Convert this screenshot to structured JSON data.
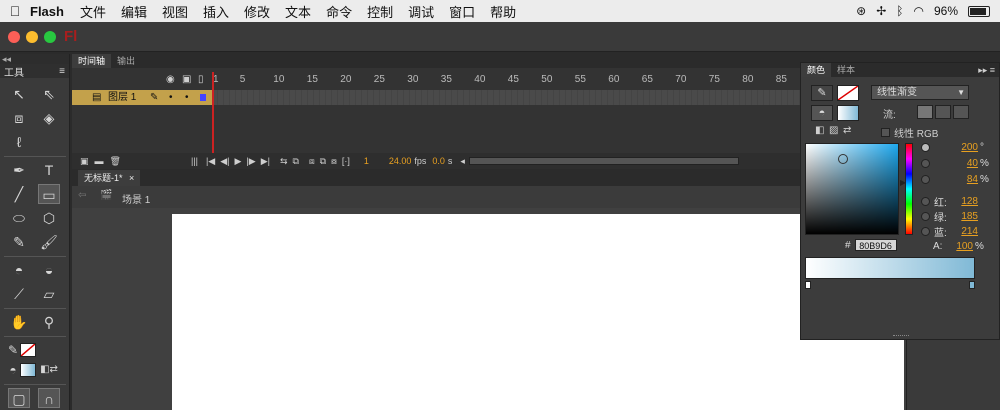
{
  "menubar": {
    "app_name": "Flash",
    "items": [
      "文件",
      "编辑",
      "视图",
      "插入",
      "修改",
      "文本",
      "命令",
      "控制",
      "调试",
      "窗口",
      "帮助"
    ],
    "battery": "96%"
  },
  "app": {
    "logo": "Fl"
  },
  "tools_panel": {
    "title": "工具",
    "strip": "◂◂"
  },
  "timeline": {
    "tabs": [
      "时间轴",
      "输出"
    ],
    "ruler_numbers": [
      "1",
      "5",
      "10",
      "15",
      "20",
      "25",
      "30",
      "35",
      "40",
      "45",
      "50",
      "55",
      "60",
      "65",
      "70",
      "75",
      "80",
      "85"
    ],
    "layer_name": "图层 1",
    "current_frame": "1",
    "fps": "24.00",
    "fps_unit": "fps",
    "time": "0.0",
    "time_unit": "s"
  },
  "document": {
    "tab_title": "无标题-1*",
    "scene": "场景 1"
  },
  "color_panel": {
    "tabs": [
      "颜色",
      "样本"
    ],
    "fill_type": "线性渐变",
    "flow_label": "流:",
    "linear_rgb_label": "线性 RGB",
    "hex_label": "#",
    "hex": "80B9D6",
    "h": {
      "value": "200",
      "unit": "°"
    },
    "s": {
      "value": "40",
      "unit": "%"
    },
    "b": {
      "value": "84",
      "unit": "%"
    },
    "r": {
      "label": "红:",
      "value": "128"
    },
    "g": {
      "label": "绿:",
      "value": "185"
    },
    "bl": {
      "label": "蓝:",
      "value": "214"
    },
    "alpha": {
      "label": "A:",
      "value": "100",
      "unit": "%"
    },
    "gradient_start": "#ffffff",
    "gradient_end": "#80b9d6"
  }
}
